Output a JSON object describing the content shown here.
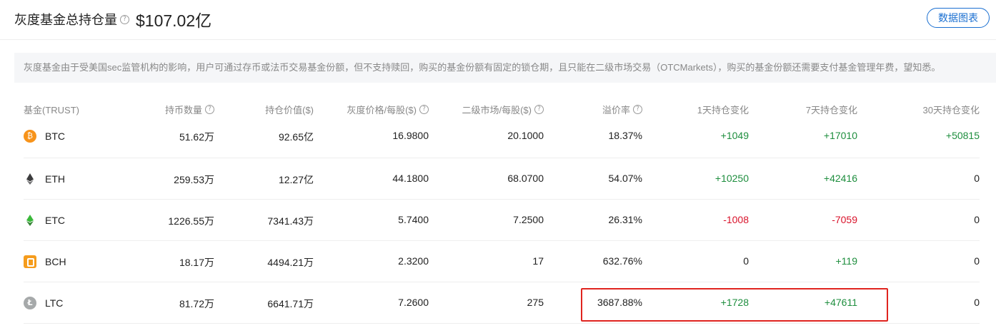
{
  "header": {
    "title": "灰度基金总持仓量",
    "total": "$107.02亿",
    "chart_button": "数据图表"
  },
  "notice": "灰度基金由于受美国sec监管机构的影响，用户可通过存币或法币交易基金份额，但不支持赎回，购买的基金份额有固定的锁仓期，且只能在二级市场交易（OTCMarkets），购买的基金份额还需要支付基金管理年费，望知悉。",
  "table": {
    "columns": [
      "基金(TRUST)",
      "持币数量",
      "持仓价值($)",
      "灰度价格/每股($)",
      "二级市场/每股($)",
      "溢价率",
      "1天持仓变化",
      "7天持仓变化",
      "30天持仓变化"
    ],
    "rows": [
      {
        "coin": "BTC",
        "icon": "btc-icon",
        "qty": "51.62万",
        "value": "92.65亿",
        "price": "16.9800",
        "secondary": "20.1000",
        "premium": "18.37%",
        "d1": "+1049",
        "d7": "+17010",
        "d30": "+50815"
      },
      {
        "coin": "ETH",
        "icon": "eth-icon",
        "qty": "259.53万",
        "value": "12.27亿",
        "price": "44.1800",
        "secondary": "68.0700",
        "premium": "54.07%",
        "d1": "+10250",
        "d7": "+42416",
        "d30": "0"
      },
      {
        "coin": "ETC",
        "icon": "etc-icon",
        "qty": "1226.55万",
        "value": "7341.43万",
        "price": "5.7400",
        "secondary": "7.2500",
        "premium": "26.31%",
        "d1": "-1008",
        "d7": "-7059",
        "d30": "0"
      },
      {
        "coin": "BCH",
        "icon": "bch-icon",
        "qty": "18.17万",
        "value": "4494.21万",
        "price": "2.3200",
        "secondary": "17",
        "premium": "632.76%",
        "d1": "0",
        "d7": "+119",
        "d30": "0"
      },
      {
        "coin": "LTC",
        "icon": "ltc-icon",
        "qty": "81.72万",
        "value": "6641.71万",
        "price": "7.2600",
        "secondary": "275",
        "premium": "3687.88%",
        "d1": "+1728",
        "d7": "+47611",
        "d30": "0"
      }
    ]
  },
  "colors": {
    "positive": "#1e8e3e",
    "negative": "#d9132b",
    "accent": "#1a6fd1",
    "highlight_box": "#e0241f"
  }
}
